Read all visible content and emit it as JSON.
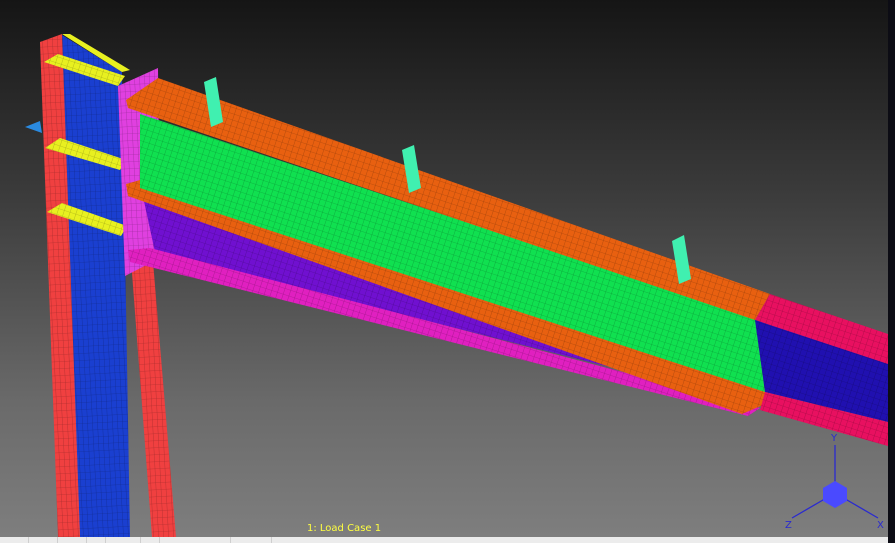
{
  "viewport": {
    "load_case_label": "1: Load Case 1",
    "triad": {
      "x_label": "X",
      "y_label": "Y",
      "z_label": "Z"
    }
  },
  "colors": {
    "column_flange": "#f04040",
    "column_web": "#1a3fd0",
    "stiffener": "#e8f020",
    "end_plate": "#e040e0",
    "beam_flange": "#e86010",
    "beam_web": "#10e050",
    "haunch_web": "#7010d0",
    "haunch_flange": "#e020c0",
    "beam_section_web": "#2010b0",
    "beam_section_flange": "#e81060",
    "purlin_cleat": "#40f0b0",
    "load_case_text": "#ffff40"
  }
}
